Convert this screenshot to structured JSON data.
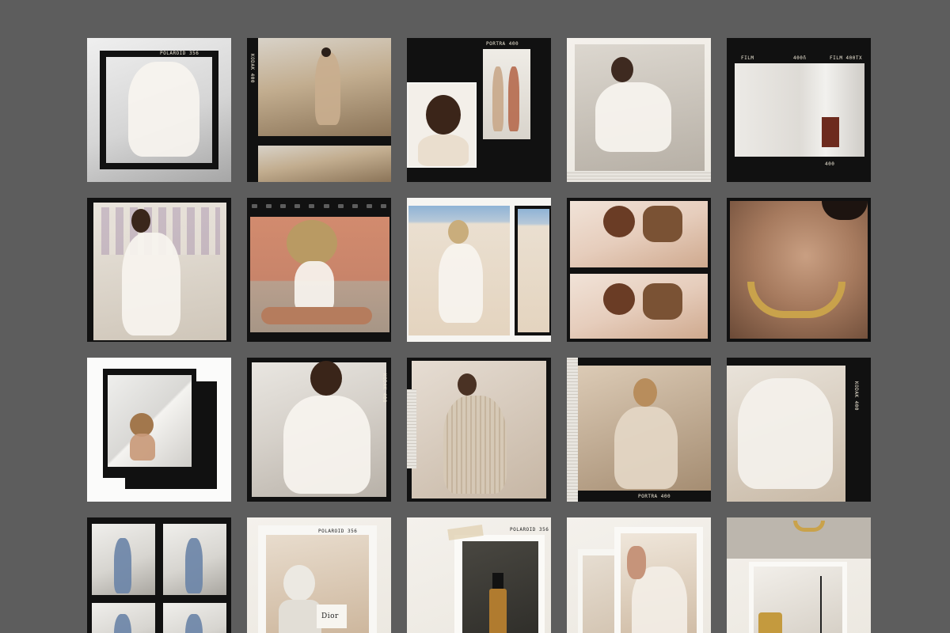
{
  "colors": {
    "background": "#5d5d5d",
    "film_black": "#111111",
    "paper": "#f4f1ec"
  },
  "film_labels": {
    "polaroid": "POLAROID 356",
    "film": "FILM",
    "film_400": "400ñ",
    "film_400tx": "FILM 400TX",
    "num_400": "400",
    "kodak": "KODAK 400",
    "portra": "PORTRA 400",
    "dior": "Dior"
  },
  "tiles": [
    {
      "name": "tile-white-wrap-top",
      "icon": "photo-icon"
    },
    {
      "name": "tile-coat-rocks",
      "icon": "photo-icon"
    },
    {
      "name": "tile-smiling-portrait",
      "icon": "photo-icon"
    },
    {
      "name": "tile-white-blouse",
      "icon": "photo-icon"
    },
    {
      "name": "tile-interior-film",
      "icon": "photo-icon"
    },
    {
      "name": "tile-white-cardigan",
      "icon": "photo-icon"
    },
    {
      "name": "tile-straw-hat",
      "icon": "photo-icon"
    },
    {
      "name": "tile-desert-girl",
      "icon": "photo-icon"
    },
    {
      "name": "tile-beach-picnic",
      "icon": "photo-icon"
    },
    {
      "name": "tile-gold-necklace",
      "icon": "photo-icon"
    },
    {
      "name": "tile-sun-hat-frame",
      "icon": "photo-icon"
    },
    {
      "name": "tile-white-knit",
      "icon": "photo-icon"
    },
    {
      "name": "tile-striped-suit",
      "icon": "photo-icon"
    },
    {
      "name": "tile-beige-blazer",
      "icon": "photo-icon"
    },
    {
      "name": "tile-white-top-back",
      "icon": "photo-icon"
    },
    {
      "name": "tile-contact-sheet",
      "icon": "photo-icon"
    },
    {
      "name": "tile-bust-still-life",
      "icon": "photo-icon"
    },
    {
      "name": "tile-serum-bottle",
      "icon": "photo-icon"
    },
    {
      "name": "tile-hand-polaroid",
      "icon": "photo-icon"
    },
    {
      "name": "tile-bathroom-still",
      "icon": "photo-icon"
    }
  ]
}
